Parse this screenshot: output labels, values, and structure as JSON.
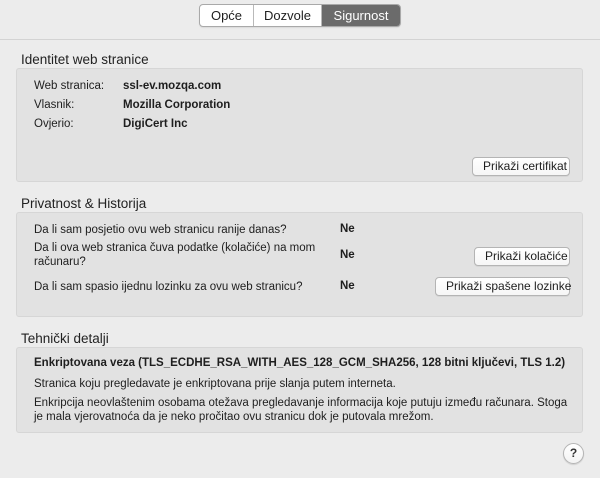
{
  "tabs": [
    {
      "label": "Opće",
      "active": false
    },
    {
      "label": "Dozvole",
      "active": false
    },
    {
      "label": "Sigurnost",
      "active": true
    }
  ],
  "identity": {
    "title": "Identitet web stranice",
    "rows": [
      {
        "label": "Web stranica:",
        "value": "ssl-ev.mozqa.com"
      },
      {
        "label": "Vlasnik:",
        "value": "Mozilla Corporation"
      },
      {
        "label": "Ovjerio:",
        "value": "DigiCert Inc"
      }
    ],
    "button": "Prikaži certifikat"
  },
  "privacy": {
    "title": "Privatnost & Historija",
    "rows": [
      {
        "question": "Da li sam posjetio ovu web stranicu ranije danas?",
        "answer": "Ne"
      },
      {
        "question": "Da li ova web stranica čuva podatke (kolačiće) na mom računaru?",
        "answer": "Ne",
        "button": "Prikaži kolačiće"
      },
      {
        "question": "Da li sam spasio ijednu lozinku za ovu web stranicu?",
        "answer": "Ne",
        "button": "Prikaži spašene lozinke"
      }
    ]
  },
  "technical": {
    "title": "Tehnički detalji",
    "heading": "Enkriptovana veza (TLS_ECDHE_RSA_WITH_AES_128_GCM_SHA256, 128 bitni ključevi, TLS 1.2)",
    "p1": "Stranica koju pregledavate je enkriptovana prije slanja putem interneta.",
    "p2": "Enkripcija neovlaštenim osobama otežava pregledavanje informacija koje putuju između računara. Stoga je mala vjerovatnoća da je neko pročitao ovu stranicu dok je putovala mrežom."
  },
  "help": "?"
}
